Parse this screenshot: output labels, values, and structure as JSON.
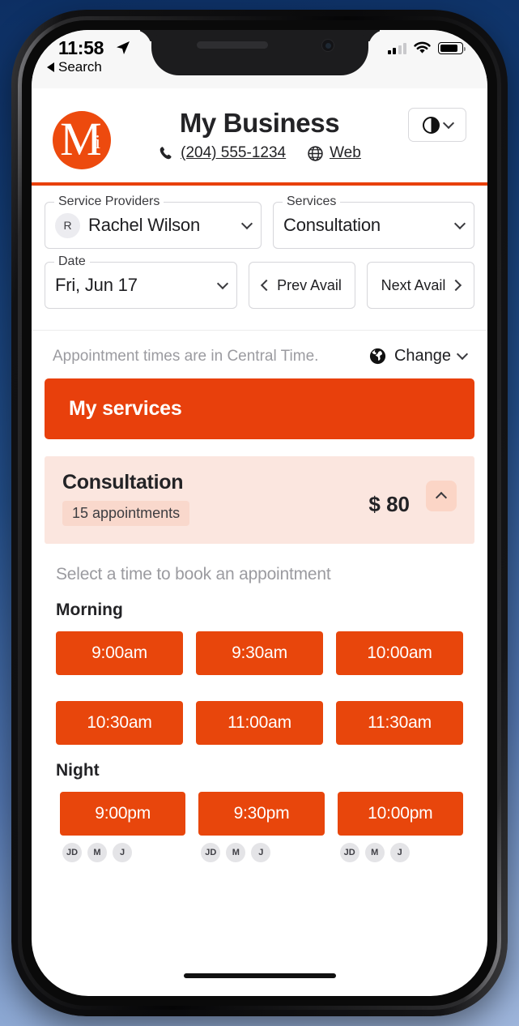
{
  "status_bar": {
    "time": "11:58",
    "back_label": "Search",
    "location_icon": "location-arrow-icon",
    "signal_icon": "cellular-signal-icon",
    "wifi_icon": "wifi-icon",
    "battery_icon": "battery-icon"
  },
  "header": {
    "logo_letter": "M",
    "logo_accent": "i",
    "business_name": "My Business",
    "phone": "(204) 555-1234",
    "web": "Web",
    "phone_icon": "phone-icon",
    "web_icon": "globe-icon",
    "contrast_icon": "contrast-icon",
    "accent_color": "#E8400C"
  },
  "filters": {
    "service_providers": {
      "label": "Service Providers",
      "value": "Rachel Wilson",
      "avatar_initial": "R"
    },
    "services": {
      "label": "Services",
      "value": "Consultation"
    },
    "date": {
      "label": "Date",
      "value": "Fri, Jun 17"
    },
    "prev_avail": "Prev Avail",
    "next_avail": "Next Avail"
  },
  "timezone": {
    "note": "Appointment times are in Central Time.",
    "change_label": "Change",
    "globe_icon": "globe-filled-icon"
  },
  "services_banner": {
    "title": "My services"
  },
  "service_card": {
    "title": "Consultation",
    "appointments_badge": "15 appointments",
    "price": "$ 80",
    "collapse_icon": "chevron-up-icon"
  },
  "slots": {
    "hint": "Select a time to book an appointment",
    "sections": [
      {
        "title": "Morning",
        "rows": [
          [
            {
              "time": "9:00am",
              "avatars": []
            },
            {
              "time": "9:30am",
              "avatars": []
            },
            {
              "time": "10:00am",
              "avatars": []
            }
          ],
          [
            {
              "time": "10:30am",
              "avatars": []
            },
            {
              "time": "11:00am",
              "avatars": []
            },
            {
              "time": "11:30am",
              "avatars": []
            }
          ]
        ]
      },
      {
        "title": "Night",
        "rows": [
          [
            {
              "time": "9:00pm",
              "avatars": [
                "JD",
                "M",
                "J"
              ]
            },
            {
              "time": "9:30pm",
              "avatars": [
                "JD",
                "M",
                "J"
              ]
            },
            {
              "time": "10:00pm",
              "avatars": [
                "JD",
                "M",
                "J"
              ]
            }
          ]
        ]
      }
    ]
  }
}
